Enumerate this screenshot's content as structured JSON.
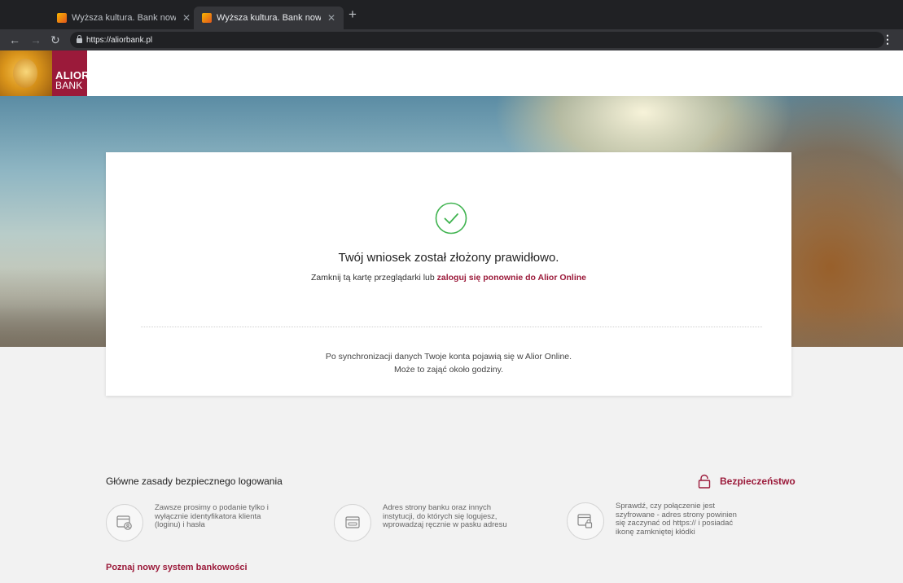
{
  "browser": {
    "tabs": [
      {
        "title": "Wyższa kultura. Bank nowości"
      },
      {
        "title": "Wyższa kultura. Bank nowości"
      }
    ],
    "new_tab": "+",
    "url": "https://aliorbank.pl"
  },
  "header": {
    "logo_line1": "ALIOR",
    "logo_line2": "BANK"
  },
  "card": {
    "title": "Twój wniosek został złożony prawidłowo.",
    "subtitle_prefix": "Zamknij tą kartę przeglądarki lub ",
    "subtitle_link": "zaloguj się ponownie do Alior Online",
    "note_line1": "Po synchronizacji danych Twoje konta pojawią się w Alior Online.",
    "note_line2": "Może to zająć około godziny."
  },
  "security": {
    "heading": "Główne zasady bezpiecznego logowania",
    "link_label": "Bezpieczeństwo",
    "tips": [
      {
        "lines": [
          "Zawsze prosimy o podanie tylko i",
          "wyłącznie identyfikatora klienta",
          "(loginu) i hasła"
        ]
      },
      {
        "lines": [
          "Adres strony banku oraz innych",
          "instytucji, do których się logujesz,",
          "wprowadzaj ręcznie w pasku adresu"
        ]
      },
      {
        "lines": [
          "Sprawdź, czy połączenie jest",
          "szyfrowane - adres strony powinien",
          "się zaczynać od https:// i posiadać",
          "ikonę zamkniętej kłódki"
        ]
      }
    ]
  },
  "footer": {
    "new_system_link": "Poznaj nowy system bankowości"
  },
  "colors": {
    "brand": "#9b1a3a",
    "success": "#3fb34f"
  }
}
